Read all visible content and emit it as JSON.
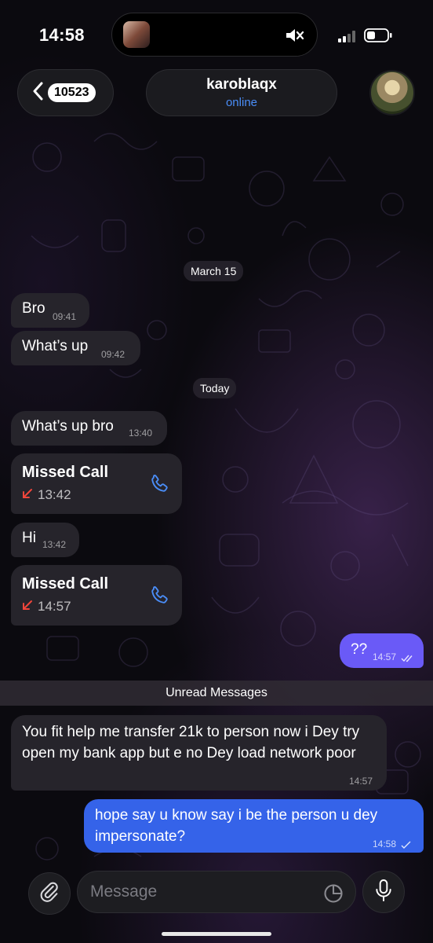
{
  "status_bar": {
    "time": "14:58",
    "icons": [
      "silent-mode-icon",
      "signal-icon",
      "battery-icon"
    ]
  },
  "header": {
    "unread_count": "10523",
    "contact_name": "karoblaqx",
    "contact_status": "online"
  },
  "chat": {
    "date_march": "March 15",
    "date_today": "Today",
    "messages": [
      {
        "text": "Bro",
        "time": "09:41"
      },
      {
        "text": "What’s up",
        "time": "09:42"
      },
      {
        "text": "What’s up bro",
        "time": "13:40"
      },
      {
        "type": "call",
        "label": "Missed Call",
        "time": "13:42"
      },
      {
        "text": "Hi",
        "time": "13:42"
      },
      {
        "type": "call",
        "label": "Missed Call",
        "time": "14:57"
      },
      {
        "text": "??",
        "time": "14:57",
        "outgoing": true
      },
      {
        "text": "You fit help me transfer 21k to person now i Dey try open my bank app but e no Dey load network poor",
        "time": "14:57"
      },
      {
        "text": "hope say u know say i be the person u dey impersonate?",
        "time": "14:58",
        "outgoing": true
      }
    ],
    "unread_divider": "Unread Messages"
  },
  "input": {
    "placeholder": "Message"
  },
  "colors": {
    "accent_blue": "#4a8df7",
    "outgoing_purple": "#6a5af7",
    "outgoing_blue": "#3563e9",
    "incoming_bubble": "#26242b",
    "missed_red": "#f0453b"
  }
}
